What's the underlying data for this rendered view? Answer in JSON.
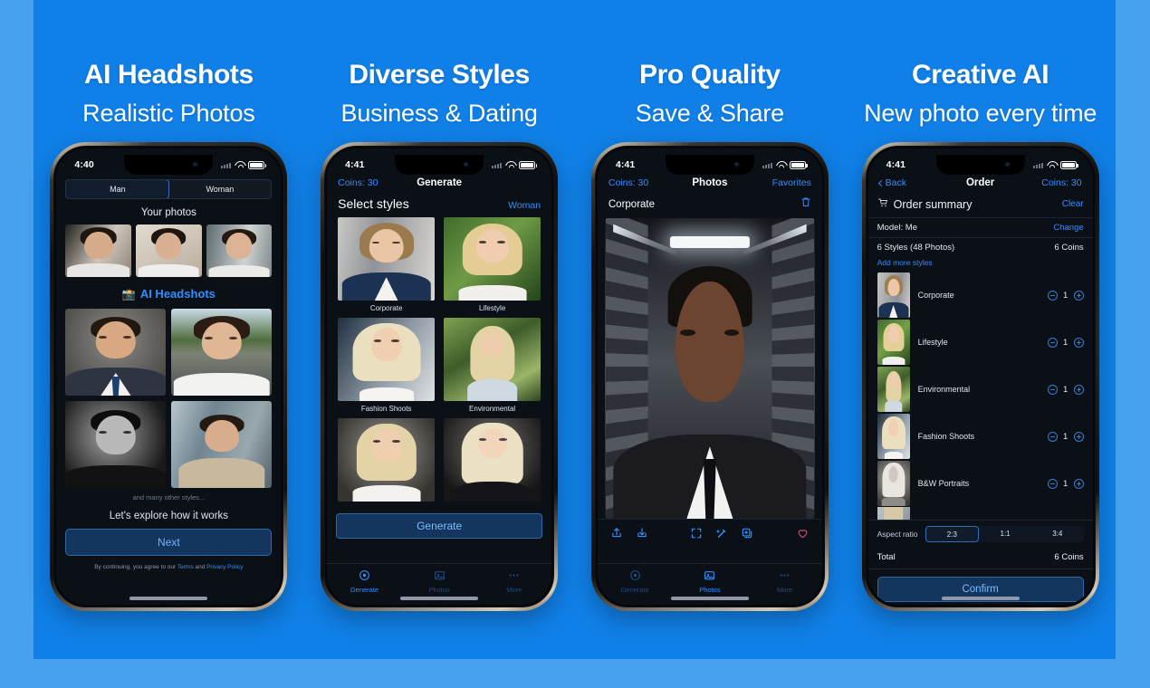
{
  "theme": {
    "background": "#47a1ee",
    "panel": "#1080e8",
    "accent": "#2f8fff",
    "screen_bg": "#0b1017"
  },
  "panels": [
    {
      "headline_top": "AI Headshots",
      "headline_sub": "Realistic Photos",
      "status": {
        "time": "4:40"
      },
      "segmented": {
        "options": [
          "Man",
          "Woman"
        ],
        "selected": "Man"
      },
      "your_photos_title": "Your photos",
      "brand": {
        "emoji": "📸",
        "label": "AI Headshots"
      },
      "many_other": "and many other styles...",
      "explore_text": "Let's explore how it works",
      "next_label": "Next",
      "legal": {
        "prefix": "By continuing, you agree to our ",
        "terms": "Terms",
        "and": " and ",
        "privacy": "Privacy Policy"
      }
    },
    {
      "headline_top": "Diverse Styles",
      "headline_sub": "Business & Dating",
      "status": {
        "time": "4:41"
      },
      "nav": {
        "left": "Coins: 30",
        "title": "Generate",
        "right": ""
      },
      "section_title": "Select styles",
      "gender_link": "Woman",
      "styles": [
        {
          "label": "Corporate"
        },
        {
          "label": "Lifestyle"
        },
        {
          "label": "Fashion Shoots"
        },
        {
          "label": "Environmental"
        },
        {
          "label": ""
        },
        {
          "label": ""
        }
      ],
      "generate_label": "Generate",
      "tabs": [
        {
          "label": "Generate",
          "icon": "generate-icon",
          "active": true
        },
        {
          "label": "Photos",
          "icon": "photos-icon",
          "active": false
        },
        {
          "label": "More",
          "icon": "more-icon",
          "active": false
        }
      ]
    },
    {
      "headline_top": "Pro Quality",
      "headline_sub": "Save & Share",
      "status": {
        "time": "4:41"
      },
      "nav": {
        "left": "Coins: 30",
        "title": "Photos",
        "right": "Favorites"
      },
      "photo_name": "Corporate",
      "toolbar_icons": [
        "share-icon",
        "download-icon",
        "fullscreen-icon",
        "magic-wand-icon",
        "duplicate-icon",
        "heart-icon"
      ],
      "tabs": [
        {
          "label": "Generate",
          "icon": "generate-icon",
          "active": false
        },
        {
          "label": "Photos",
          "icon": "photos-icon",
          "active": true
        },
        {
          "label": "More",
          "icon": "more-icon",
          "active": false
        }
      ]
    },
    {
      "headline_top": "Creative AI",
      "headline_sub": "New photo every time",
      "status": {
        "time": "4:41"
      },
      "nav": {
        "left": "Back",
        "title": "Order",
        "right": "Coins: 30"
      },
      "summary": {
        "icon": "cart-icon",
        "title": "Order summary",
        "clear": "Clear"
      },
      "model_row": {
        "label": "Model: Me",
        "action": "Change"
      },
      "styles_row": {
        "label": "6 Styles (48 Photos)",
        "value": "6 Coins"
      },
      "add_more": "Add more styles",
      "order_items": [
        {
          "name": "Corporate",
          "qty": "1"
        },
        {
          "name": "Lifestyle",
          "qty": "1"
        },
        {
          "name": "Environmental",
          "qty": "1"
        },
        {
          "name": "Fashion Shoots",
          "qty": "1"
        },
        {
          "name": "B&W Portraits",
          "qty": "1"
        }
      ],
      "aspect_ratio": {
        "label": "Aspect ratio",
        "options": [
          "2:3",
          "1:1",
          "3:4"
        ],
        "selected": "2:3"
      },
      "total": {
        "label": "Total",
        "value": "6 Coins"
      },
      "confirm_label": "Confirm"
    }
  ]
}
